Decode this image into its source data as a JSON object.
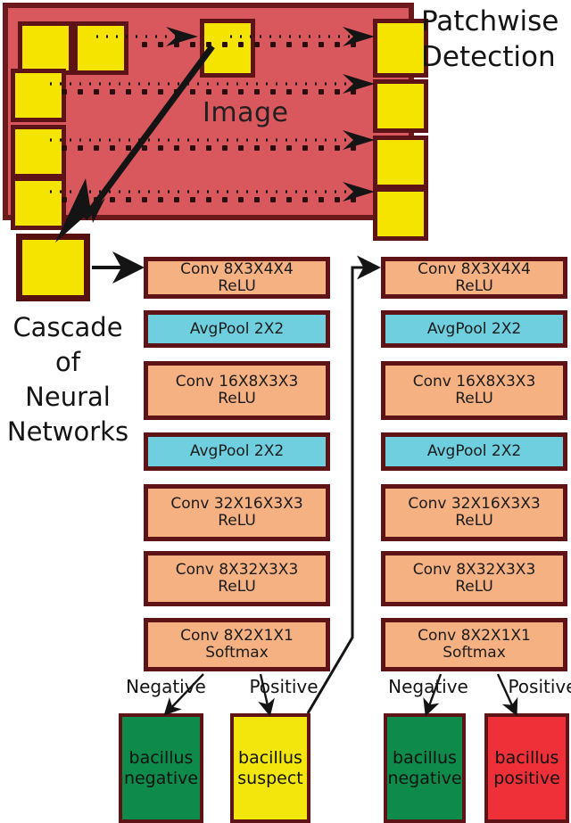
{
  "figure": {
    "image_label": "Image",
    "patchwise_title_line1": "Patchwise",
    "patchwise_title_line2": "Detection",
    "cascade_line1": "Cascade",
    "cascade_line2": "of",
    "cascade_line3": "Neural",
    "cascade_line4": "Networks"
  },
  "colors": {
    "image_background": "#D9585E",
    "dark_border": "#5E1316",
    "patch_yellow": "#F5E400",
    "conv_orange": "#F6B183",
    "pool_cyan": "#6FCFDF",
    "negative_green": "#0E8A4A",
    "suspect_yellow": "#F2E60C",
    "positive_red": "#EF3038"
  },
  "stage1": {
    "name": "first-network",
    "layers": [
      {
        "type": "conv",
        "line1": "Conv 8X3X4X4",
        "line2": "ReLU"
      },
      {
        "type": "pool",
        "line1": "AvgPool 2X2",
        "line2": ""
      },
      {
        "type": "conv",
        "line1": "Conv 16X8X3X3",
        "line2": "ReLU"
      },
      {
        "type": "pool",
        "line1": "AvgPool 2X2",
        "line2": ""
      },
      {
        "type": "conv",
        "line1": "Conv 32X16X3X3",
        "line2": "ReLU"
      },
      {
        "type": "conv",
        "line1": "Conv 8X32X3X3",
        "line2": "ReLU"
      },
      {
        "type": "conv",
        "line1": "Conv 8X2X1X1",
        "line2": "Softmax"
      }
    ],
    "branches": [
      {
        "label": "Negative",
        "result_line1": "bacillus",
        "result_line2": "negative",
        "result_color": "green"
      },
      {
        "label": "Positive",
        "result_line1": "bacillus",
        "result_line2": "suspect",
        "result_color": "yellow"
      }
    ]
  },
  "stage2": {
    "name": "second-network",
    "layers": [
      {
        "type": "conv",
        "line1": "Conv 8X3X4X4",
        "line2": "ReLU"
      },
      {
        "type": "pool",
        "line1": "AvgPool 2X2",
        "line2": ""
      },
      {
        "type": "conv",
        "line1": "Conv 16X8X3X3",
        "line2": "ReLU"
      },
      {
        "type": "pool",
        "line1": "AvgPool 2X2",
        "line2": ""
      },
      {
        "type": "conv",
        "line1": "Conv 32X16X3X3",
        "line2": "ReLU"
      },
      {
        "type": "conv",
        "line1": "Conv 8X32X3X3",
        "line2": "ReLU"
      },
      {
        "type": "conv",
        "line1": "Conv 8X2X1X1",
        "line2": "Softmax"
      }
    ],
    "branches": [
      {
        "label": "Negative",
        "result_line1": "bacillus",
        "result_line2": "negative",
        "result_color": "green"
      },
      {
        "label": "Positive",
        "result_line1": "bacillus",
        "result_line2": "positive",
        "result_color": "red"
      }
    ]
  }
}
